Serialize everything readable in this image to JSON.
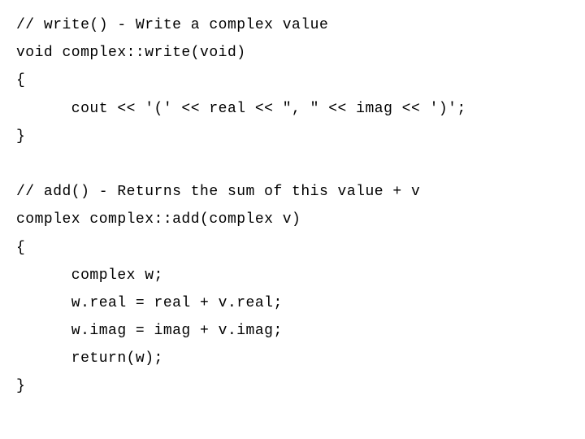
{
  "code": {
    "lines": [
      "// write() - Write a complex value",
      "void complex::write(void)",
      "{",
      "      cout << '(' << real << \", \" << imag << ')';",
      "}",
      "",
      "// add() - Returns the sum of this value + v",
      "complex complex::add(complex v)",
      "{",
      "      complex w;",
      "      w.real = real + v.real;",
      "      w.imag = imag + v.imag;",
      "      return(w);",
      "}"
    ]
  }
}
